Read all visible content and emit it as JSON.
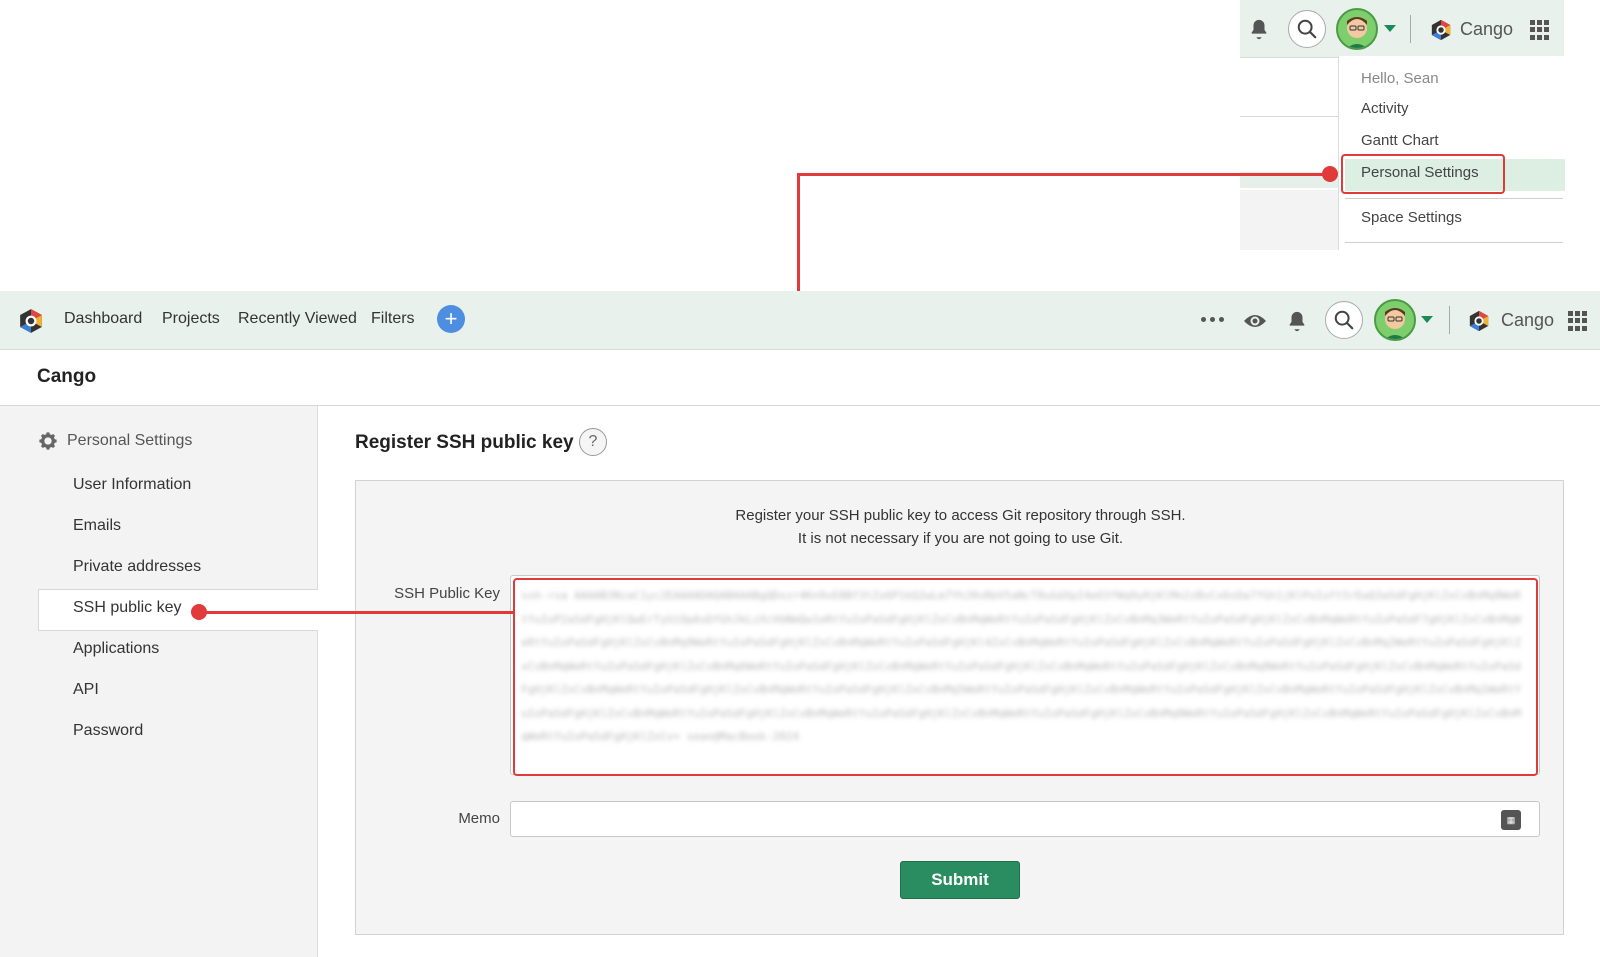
{
  "inset": {
    "space_name": "Cango",
    "menu": {
      "greeting": "Hello, Sean",
      "items": [
        "Activity",
        "Gantt Chart",
        "Personal Settings",
        "Space Settings"
      ]
    }
  },
  "header": {
    "nav": [
      "Dashboard",
      "Projects",
      "Recently Viewed",
      "Filters"
    ],
    "add_label": "+",
    "space_name": "Cango"
  },
  "space": {
    "title": "Cango"
  },
  "sidebar": {
    "heading": "Personal Settings",
    "items": [
      "User Information",
      "Emails",
      "Private addresses",
      "SSH public key",
      "Applications",
      "API",
      "Password"
    ]
  },
  "main": {
    "title": "Register SSH public key",
    "help": "?",
    "description_line1": "Register your SSH public key to access Git repository through SSH.",
    "description_line2": "It is not necessary if you are not going to use Git.",
    "ssh_label": "SSH Public Key",
    "ssh_value": "ssh-rsa AAAAB3NzaC1yc2EAAAADAQABAAABgQDxzr4Kn9vE8Bf3tZx6P1kQ2wLm7YhJ0sRbV5aNcT8uGdXpI4eO3fWq9yHjKlMn2zBvCx6sDa7fGh1jKlPoIuYt5rEwQ3aSdFgHjKlZxCvBnMq8WeRtYuIoP2aSdFgHjKlQwErTyUiOpAsDfGhJkLzXcVbNmQw1eRtYuIoPaSdFgHjKlZxCvBnMqWeRtYuIoPaSdFgHjKlZxCvBnMq3WeRtYuIoPaSdFgHjKlZxCvBnMqWeRtYuIoPaSdF7gHjKlZxCvBnMqWeRtYuIoPaSdFgHjKlZxCvBnMq9WeRtYuIoPaSdFgHjKlZxCvBnMqWeRtYuIoPaSdFgHjKl4ZxCvBnMqWeRtYuIoPaSdFgHjKlZxCvBnMqWeRtYuIoPaSdFgHjKlZxCvBnMq2WeRtYuIoPaSdFgHjKlZxCvBnMqWeRtYuIoPaSdFgHjKlZxCvBnMq6WeRtYuIoPaSdFgHjKlZxCvBnMqWeRtYuIoPaSdFgHjKlZxCvBnMqWeRtYuIoPaSdFgHjKlZxCvBnMq8WeRtYuIoPaSdFgHjKlZxCvBnMqWeRtYuIoPaSdFgHjKlZxCvBnMqWeRtYuIoPaSdFgHjKlZxCvBnMqWeRtYuIoPaSdFgHjKlZxCvBnMq5WeRtYuIoPaSdFgHjKlZxCvBnMqWeRtYuIoPaSdFgHjKlZxCvBnMqWeRtYuIoPaSdFgHjKlZxCvBnMq1WeRtYuIoPaSdFgHjKlZxCvBnMqWeRtYuIoPaSdFgHjKlZxCvBnMqWeRtYuIoPaSdFgHjKlZxCvBnMqWeRtYuIoPaSdFgHjKlZxCvBnMq0WeRtYuIoPaSdFgHjKlZxCvBnMqWeRtYuIoPaSdFgHjKlZxCvBnMqWeRtYuIoPaSdFgHjKlZxCv= sean@MacBook-2024",
    "memo_label": "Memo",
    "memo_value": "",
    "submit_label": "Submit"
  },
  "colors": {
    "brand_green": "#2a8c61",
    "annotation_red": "#e03a3a",
    "bar_bg": "#e9f1ec",
    "plus_blue": "#4d8ee0"
  }
}
